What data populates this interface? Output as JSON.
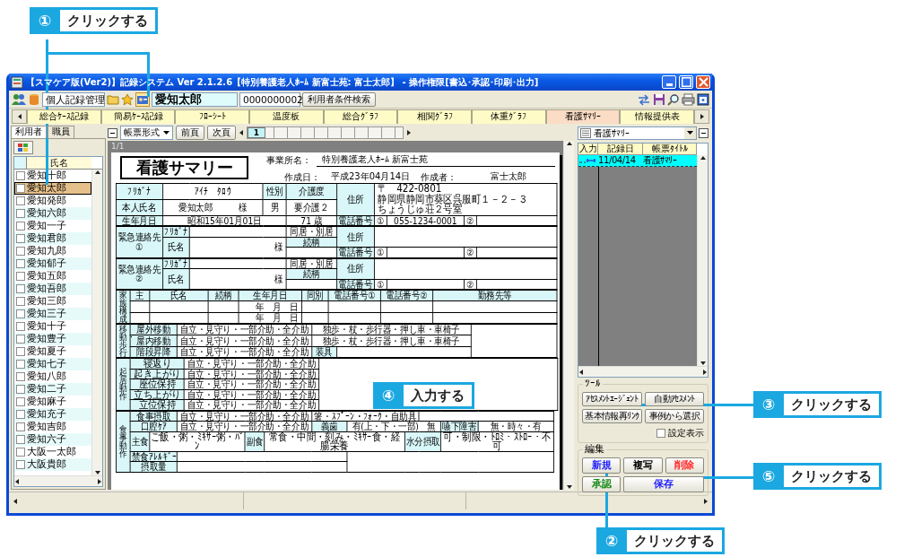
{
  "window": {
    "title": "【スマケア版(Ver2)】記録システム Ver 2.1.2.6【特別養護老人ﾎｰﾑ 新富士苑: 富士太郎】 - 操作権限[書込･承認･印刷･出力]"
  },
  "toolbar": {
    "module": "個人記録管理",
    "user_name": "愛知太郎",
    "user_id": "0000000002",
    "search_button": "利用者条件検索"
  },
  "tabs": [
    {
      "label": "総合ｹｰｽ記録",
      "selected": false
    },
    {
      "label": "簡易ｹｰｽ記録",
      "selected": false
    },
    {
      "label": "ﾌﾛｰｼｰﾄ",
      "selected": false
    },
    {
      "label": "温度板",
      "selected": false
    },
    {
      "label": "総合ｸﾞﾗﾌ",
      "selected": false
    },
    {
      "label": "相関ｸﾞﾗﾌ",
      "selected": false
    },
    {
      "label": "体重ｸﾞﾗﾌ",
      "selected": false
    },
    {
      "label": "看護ｻﾏﾘｰ",
      "selected": true
    },
    {
      "label": "情報提供表",
      "selected": false
    }
  ],
  "left_panel": {
    "tabs": [
      {
        "label": "利用者",
        "selected": true
      },
      {
        "label": "職員",
        "selected": false
      }
    ],
    "column": "氏名",
    "users": [
      {
        "name": "愛知十郎",
        "checked": false,
        "selected": false
      },
      {
        "name": "愛知太郎",
        "checked": false,
        "selected": true
      },
      {
        "name": "愛知発郎",
        "checked": false,
        "selected": false
      },
      {
        "name": "愛知六郎",
        "checked": false,
        "selected": false
      },
      {
        "name": "愛知一子",
        "checked": false,
        "selected": false
      },
      {
        "name": "愛知君郎",
        "checked": false,
        "selected": false
      },
      {
        "name": "愛知九郎",
        "checked": false,
        "selected": false
      },
      {
        "name": "愛知郁子",
        "checked": false,
        "selected": false
      },
      {
        "name": "愛知五郎",
        "checked": false,
        "selected": false
      },
      {
        "name": "愛知吾郎",
        "checked": false,
        "selected": false
      },
      {
        "name": "愛知三郎",
        "checked": false,
        "selected": false
      },
      {
        "name": "愛知三子",
        "checked": false,
        "selected": false
      },
      {
        "name": "愛知十子",
        "checked": false,
        "selected": false
      },
      {
        "name": "愛知豊子",
        "checked": false,
        "selected": false
      },
      {
        "name": "愛知夏子",
        "checked": false,
        "selected": false
      },
      {
        "name": "愛知七子",
        "checked": false,
        "selected": false
      },
      {
        "name": "愛知八郎",
        "checked": false,
        "selected": false
      },
      {
        "name": "愛知二子",
        "checked": false,
        "selected": false
      },
      {
        "name": "愛知麻子",
        "checked": false,
        "selected": false
      },
      {
        "name": "愛知充子",
        "checked": false,
        "selected": false
      },
      {
        "name": "愛知吉郎",
        "checked": false,
        "selected": false
      },
      {
        "name": "愛知六子",
        "checked": false,
        "selected": false
      },
      {
        "name": "大阪一太郎",
        "checked": false,
        "selected": false
      },
      {
        "name": "大阪貴郎",
        "checked": false,
        "selected": false
      }
    ]
  },
  "viewer": {
    "format": "帳票形式",
    "prev": "前頁",
    "next": "次頁",
    "pages": [
      {
        "label": "1",
        "selected": true
      }
    ],
    "page_counter": "1/1"
  },
  "form": {
    "title": "看護サマリー",
    "facility_label": "事業所名：",
    "facility": "特別養護老人ﾎｰﾑ 新富士苑",
    "date_label": "作成日：",
    "date": "平成23年04月14日",
    "author_label": "作成者：",
    "author": "富士太郎",
    "sections": [
      {
        "kind": "basic",
        "rows": [
          [
            {
              "kind": "label",
              "text": "ﾌﾘｶﾞﾅ"
            },
            {
              "kind": "value",
              "text": "ｱｲﾁ　ﾀﾛｳ",
              "colspan": 2
            },
            {
              "kind": "label",
              "text": "性別"
            },
            {
              "kind": "label",
              "text": "介護度"
            },
            {
              "kind": "label",
              "text": "住所",
              "rowspan": 2
            },
            {
              "kind": "multiline",
              "lines": [
                "〒　422-0801",
                "静岡県静岡市葵区呉服町１－２－３",
                "ちょうじゅ荘２号室"
              ],
              "colspan": 4,
              "rowspan": 2
            }
          ],
          [
            {
              "kind": "label",
              "text": "本人氏名"
            },
            {
              "kind": "value",
              "text": "愛知太郎　　　様",
              "colspan": 2
            },
            {
              "kind": "value",
              "text": "男"
            },
            {
              "kind": "value",
              "text": "要介護２"
            }
          ],
          [
            {
              "kind": "label",
              "text": "生年月日"
            },
            {
              "kind": "value",
              "text": "昭和15年01月01日",
              "colspan": 3
            },
            {
              "kind": "value",
              "text": "71 歳"
            },
            {
              "kind": "label",
              "text": "電話番号"
            },
            {
              "kind": "value",
              "text": "①"
            },
            {
              "kind": "value",
              "text": "055-1234-0001"
            },
            {
              "kind": "value",
              "text": "②"
            },
            {
              "kind": "value"
            }
          ]
        ]
      },
      {
        "kind": "contact",
        "rows": [
          [
            {
              "kind": "label",
              "text": "緊急連絡先①",
              "rowspan": 3
            },
            {
              "kind": "label",
              "text": "ﾌﾘｶﾞﾅ"
            },
            {
              "kind": "value",
              "colspan": 2
            },
            {
              "kind": "value",
              "text": "同居・別居"
            },
            {
              "kind": "label",
              "text": "住所",
              "rowspan": 2
            },
            {
              "kind": "value",
              "colspan": 4,
              "rowspan": 2
            }
          ],
          [
            {
              "kind": "label",
              "text": "氏名",
              "rowspan": 2
            },
            {
              "kind": "suffix",
              "text": "様",
              "colspan": 2,
              "rowspan": 2
            },
            {
              "kind": "label",
              "text": "続柄"
            }
          ],
          [
            {
              "kind": "value"
            },
            {
              "kind": "label",
              "text": "電話番号"
            },
            {
              "kind": "value",
              "text": "①"
            },
            {
              "kind": "value"
            },
            {
              "kind": "value",
              "text": "②"
            },
            {
              "kind": "value"
            }
          ]
        ]
      },
      {
        "kind": "contact",
        "rows": [
          [
            {
              "kind": "label",
              "text": "緊急連絡先②",
              "rowspan": 3
            },
            {
              "kind": "label",
              "text": "ﾌﾘｶﾞﾅ"
            },
            {
              "kind": "value",
              "colspan": 2
            },
            {
              "kind": "value",
              "text": "同居・別居"
            },
            {
              "kind": "label",
              "text": "住所",
              "rowspan": 2
            },
            {
              "kind": "value",
              "colspan": 4,
              "rowspan": 2
            }
          ],
          [
            {
              "kind": "label",
              "text": "氏名",
              "rowspan": 2
            },
            {
              "kind": "suffix",
              "text": "様",
              "colspan": 2,
              "rowspan": 2
            },
            {
              "kind": "label",
              "text": "続柄"
            }
          ],
          [
            {
              "kind": "value"
            },
            {
              "kind": "label",
              "text": "電話番号"
            },
            {
              "kind": "value",
              "text": "①"
            },
            {
              "kind": "value"
            },
            {
              "kind": "value",
              "text": "②"
            },
            {
              "kind": "value"
            }
          ]
        ]
      },
      {
        "kind": "family",
        "rows": [
          [
            {
              "kind": "vertical",
              "text": "家族構成",
              "rowspan": 3
            },
            {
              "kind": "label",
              "text": "主"
            },
            {
              "kind": "label",
              "text": "氏名"
            },
            {
              "kind": "label",
              "text": "続柄"
            },
            {
              "kind": "label",
              "text": "生年月日"
            },
            {
              "kind": "label",
              "text": "同別"
            },
            {
              "kind": "label",
              "text": "電話番号①"
            },
            {
              "kind": "label",
              "text": "電話番号②"
            },
            {
              "kind": "label",
              "text": "勤務先等"
            }
          ],
          [
            {
              "kind": "value"
            },
            {
              "kind": "value"
            },
            {
              "kind": "value"
            },
            {
              "kind": "suffix",
              "text": "年　月　日"
            },
            {
              "kind": "value"
            },
            {
              "kind": "value"
            },
            {
              "kind": "value"
            },
            {
              "kind": "value"
            }
          ],
          [
            {
              "kind": "value"
            },
            {
              "kind": "value"
            },
            {
              "kind": "value"
            },
            {
              "kind": "suffix",
              "text": "年　月　日"
            },
            {
              "kind": "value"
            },
            {
              "kind": "value"
            },
            {
              "kind": "value"
            },
            {
              "kind": "value"
            }
          ]
        ]
      },
      {
        "kind": "mobility",
        "rows": [
          [
            {
              "kind": "vertical",
              "text": "移動・歩行",
              "rowspan": 3
            },
            {
              "kind": "label",
              "text": "屋外移動"
            },
            {
              "kind": "value",
              "text": "自立・見守り・一部介助・全介助"
            },
            {
              "kind": "value",
              "text": "独歩・杖・歩行器・押し車・車椅子",
              "colspan": 2
            },
            {
              "kind": "value",
              "rowspan": 3
            }
          ],
          [
            {
              "kind": "label",
              "text": "屋内移動"
            },
            {
              "kind": "value",
              "text": "自立・見守り・一部介助・全介助"
            },
            {
              "kind": "value",
              "text": "独歩・杖・歩行器・押し車・車椅子",
              "colspan": 2
            }
          ],
          [
            {
              "kind": "label",
              "text": "階段昇降"
            },
            {
              "kind": "value",
              "text": "自立・見守り・一部介助・全介助"
            },
            {
              "kind": "label",
              "text": "装具"
            },
            {
              "kind": "value"
            }
          ]
        ]
      },
      {
        "kind": "rising",
        "rows": [
          [
            {
              "kind": "vertical",
              "text": "起居動作",
              "rowspan": 5
            },
            {
              "kind": "label",
              "text": "寝返り"
            },
            {
              "kind": "value",
              "text": "自立・見守り・一部介助・全介助"
            },
            {
              "kind": "value",
              "rowspan": 5
            }
          ],
          [
            {
              "kind": "label",
              "text": "起き上がり"
            },
            {
              "kind": "value",
              "text": "自立・見守り・一部介助・全介助"
            }
          ],
          [
            {
              "kind": "label",
              "text": "座位保持"
            },
            {
              "kind": "value",
              "text": "自立・見守り・一部介助・全介助"
            }
          ],
          [
            {
              "kind": "label",
              "text": "立ち上がり"
            },
            {
              "kind": "value",
              "text": "自立・見守り・一部介助・全介助"
            }
          ],
          [
            {
              "kind": "label",
              "text": "立位保持"
            },
            {
              "kind": "value",
              "text": "自立・見守り・一部介助・全介助"
            }
          ]
        ]
      },
      {
        "kind": "meal",
        "rows": [
          [
            {
              "kind": "vertical",
              "text": "食事動作",
              "rowspan": 5
            },
            {
              "kind": "label",
              "text": "食事摂取",
              "colspan": 2
            },
            {
              "kind": "value",
              "text": "自立・見守り・一部介助・全介助",
              "colspan": 3
            },
            {
              "kind": "value",
              "text": "箸・ｽﾌﾟｰﾝ・ﾌｫｰｸ・自助具",
              "colspan": 3
            },
            {
              "kind": "value",
              "colspan": 3
            }
          ],
          [
            {
              "kind": "label",
              "text": "口腔ｹｱ",
              "colspan": 2
            },
            {
              "kind": "value",
              "text": "自立・見守り・一部介助・全介助",
              "colspan": 3
            },
            {
              "kind": "label",
              "text": "義歯"
            },
            {
              "kind": "value",
              "text": "有(上・下・一部)　無",
              "colspan": 3
            },
            {
              "kind": "label",
              "text": "嚥下障害"
            },
            {
              "kind": "value",
              "text": "無・時々・有"
            }
          ],
          [
            {
              "kind": "label",
              "text": "主食"
            },
            {
              "kind": "value",
              "text": "ご飯・粥・ﾐｷｻｰ粥・ﾊﾟﾝ",
              "colspan": 2
            },
            {
              "kind": "label",
              "text": "副食"
            },
            {
              "kind": "value",
              "text": "常食・中間・刻み・ﾐｷｻｰ食・経腸栄養",
              "colspan": 3
            },
            {
              "kind": "label",
              "text": "水分摂取",
              "colspan": 2
            },
            {
              "kind": "value",
              "text": "可・制限・ﾄﾛﾐ・ｽﾄﾛｰ・不可",
              "colspan": 2
            }
          ],
          [
            {
              "kind": "label",
              "text": "禁食ｱﾚﾙｷﾞｰ",
              "colspan": 2
            },
            {
              "kind": "value",
              "colspan": 4
            },
            {
              "kind": "value",
              "colspan": 5,
              "rowspan": 2
            }
          ],
          [
            {
              "kind": "label",
              "text": "摂取量",
              "colspan": 2
            },
            {
              "kind": "value",
              "colspan": 4
            }
          ]
        ]
      }
    ]
  },
  "record_panel": {
    "form_select": "看護ｻﾏﾘｰ",
    "columns": [
      "入力",
      "記録日",
      "帳票ﾀｲﾄﾙ"
    ],
    "records": [
      {
        "date": "11/04/14",
        "title": "看護ｻﾏﾘｰ",
        "selected": true
      }
    ],
    "tools": {
      "title": "ﾂｰﾙ",
      "buttons": [
        "ｱｾｽﾒﾝﾄｴｰｼﾞｪﾝﾄ",
        "自動ｱｾｽﾒﾝﾄ",
        "基本情報再ﾘﾝｸ",
        "事例から選択"
      ],
      "setting": {
        "label": "設定表示",
        "checked": false
      }
    },
    "edit": {
      "title": "編集",
      "buttons": [
        {
          "label": "新規",
          "color": "#1a1aff"
        },
        {
          "label": "複写",
          "color": "#000000"
        },
        {
          "label": "削除",
          "color": "#ff2020"
        },
        {
          "label": "承認",
          "color": "#1a8a1a"
        },
        {
          "label": "保存",
          "color": "#1a1aff"
        }
      ]
    }
  },
  "callouts": [
    {
      "number": "①",
      "text": "クリックする"
    },
    {
      "number": "②",
      "text": "クリックする"
    },
    {
      "number": "③",
      "text": "クリックする"
    },
    {
      "number": "④",
      "text": "入力する"
    },
    {
      "number": "⑤",
      "text": "クリックする"
    }
  ]
}
